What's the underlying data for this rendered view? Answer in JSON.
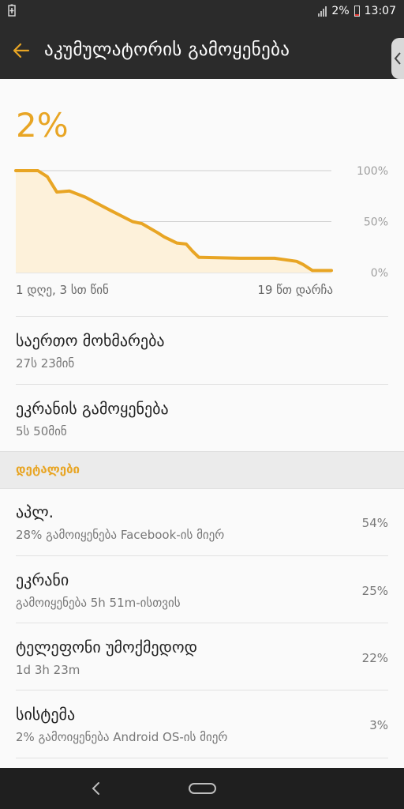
{
  "status_bar": {
    "battery_percent": "2%",
    "time": "13:07"
  },
  "app_bar": {
    "title": "აკუმულატორის გამოყენება"
  },
  "summary": {
    "percent": "2%"
  },
  "chart_data": {
    "type": "area",
    "x_start_label": "1 დღე, 3 სთ წინ",
    "x_end_label": "19 წთ დარჩა",
    "y_tick_labels": [
      "100%",
      "50%",
      "0%"
    ],
    "ylim": [
      0,
      100
    ],
    "x": [
      0,
      7,
      10,
      13,
      17,
      22,
      30,
      37,
      40,
      45,
      47,
      51,
      54,
      56,
      58,
      71,
      82,
      89,
      91,
      94,
      100
    ],
    "values": [
      100,
      100,
      94,
      79,
      80,
      74,
      61,
      50,
      48,
      39,
      35,
      29,
      28,
      21,
      15,
      14,
      14,
      11,
      8,
      2,
      2
    ],
    "colors": {
      "line": "#e8a524",
      "fill": "#fdf1da",
      "grid": "#cfcfcf"
    },
    "grid": true
  },
  "usage": {
    "total_label": "საერთო მოხმარება",
    "total_value": "27ს 23მინ",
    "screen_label": "ეკრანის გამოყენება",
    "screen_value": "5ს 50მინ"
  },
  "details": {
    "header": "დეტალები",
    "items": [
      {
        "name": "აპლ.",
        "desc": "28% გამოიყენება Facebook-ის მიერ",
        "percent": "54%"
      },
      {
        "name": "ეკრანი",
        "desc": "გამოიყენება 5h 51m-ისთვის",
        "percent": "25%"
      },
      {
        "name": "ტელეფონი უმოქმედოდ",
        "desc": "1d 3h 23m",
        "percent": "22%"
      },
      {
        "name": "სისტემა",
        "desc": "2% გამოიყენება Android OS-ის მიერ",
        "percent": "3%"
      }
    ]
  },
  "icons": {
    "status_left": "battery-charging-icon",
    "back": "back-arrow-icon",
    "nav_back": "nav-back-icon",
    "nav_home": "nav-home-icon"
  }
}
